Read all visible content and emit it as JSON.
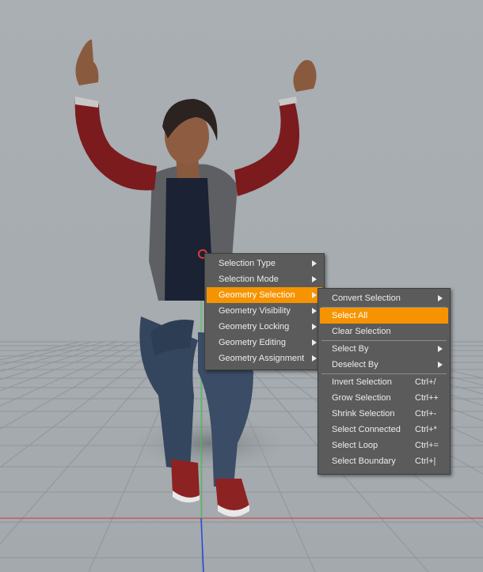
{
  "colors": {
    "background": "#a7adb1",
    "menu_bg": "#5b5b5b",
    "highlight": "#f59400",
    "menu_text": "#ececec"
  },
  "scene": {
    "figure": "woman-seated-arms-raised",
    "grid": true,
    "axes": [
      "x-axis-red",
      "y-axis-green",
      "z-axis-blue"
    ]
  },
  "main_menu": {
    "items": [
      {
        "label": "Selection Type",
        "submenu": true
      },
      {
        "label": "Selection Mode",
        "submenu": true
      },
      {
        "label": "Geometry Selection",
        "submenu": true,
        "highlighted": true
      },
      {
        "label": "Geometry Visibility",
        "submenu": true
      },
      {
        "label": "Geometry Locking",
        "submenu": true
      },
      {
        "label": "Geometry Editing",
        "submenu": true
      },
      {
        "label": "Geometry Assignment",
        "submenu": true
      }
    ]
  },
  "sub_menu": {
    "items": [
      {
        "label": "Convert Selection",
        "shortcut": "",
        "submenu": true
      },
      {
        "label": "Select All",
        "shortcut": "",
        "highlighted": true
      },
      {
        "label": "Clear Selection",
        "shortcut": ""
      },
      {
        "label": "Select By",
        "shortcut": "",
        "submenu": true
      },
      {
        "label": "Deselect By",
        "shortcut": "",
        "submenu": true
      },
      {
        "label": "Invert Selection",
        "shortcut": "Ctrl+/"
      },
      {
        "label": "Grow Selection",
        "shortcut": "Ctrl++"
      },
      {
        "label": "Shrink Selection",
        "shortcut": "Ctrl+-"
      },
      {
        "label": "Select Connected",
        "shortcut": "Ctrl+*"
      },
      {
        "label": "Select Loop",
        "shortcut": "Ctrl+="
      },
      {
        "label": "Select Boundary",
        "shortcut": "Ctrl+|"
      }
    ]
  }
}
